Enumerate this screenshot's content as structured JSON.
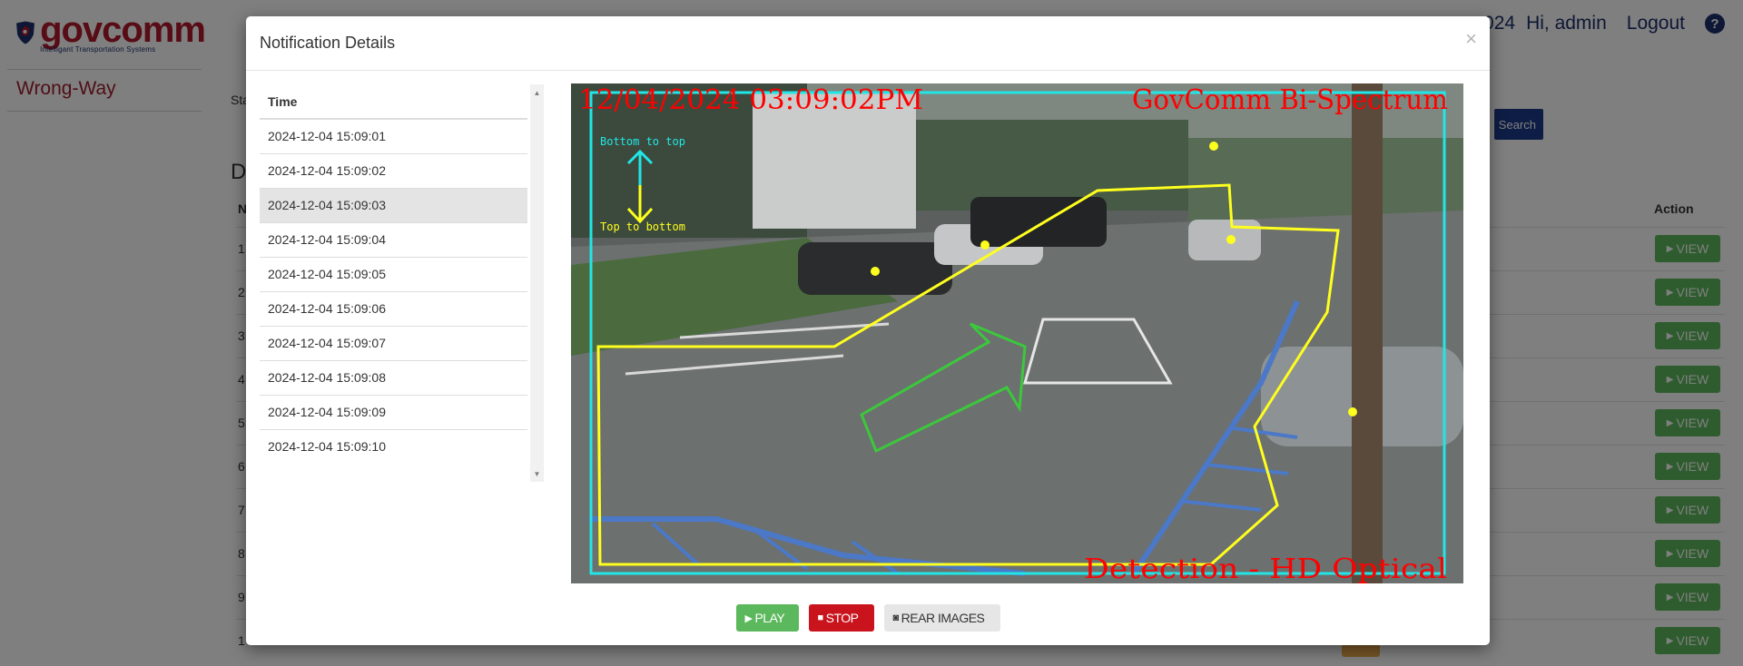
{
  "brand": {
    "name": "govcomm",
    "tagline": "Intelligant Transportation Systems"
  },
  "sidebar": {
    "active_item": "Wrong-Way"
  },
  "header": {
    "date_fragment": "024",
    "greeting": "Hi, admin",
    "logout": "Logout",
    "help": "?"
  },
  "background": {
    "search_button": "Search",
    "action_header": "Action",
    "view_label": "VIEW",
    "fragments": {
      "sta": "Sta",
      "d": "D",
      "n": "N",
      "rows": [
        "1",
        "2",
        "3",
        "4",
        "5",
        "6",
        "7",
        "8",
        "9",
        "1"
      ]
    }
  },
  "modal": {
    "title": "Notification Details",
    "close": "×",
    "table": {
      "header": "Time",
      "rows": [
        "2024-12-04 15:09:01",
        "2024-12-04 15:09:02",
        "2024-12-04 15:09:03",
        "2024-12-04 15:09:04",
        "2024-12-04 15:09:05",
        "2024-12-04 15:09:06",
        "2024-12-04 15:09:07",
        "2024-12-04 15:09:08",
        "2024-12-04 15:09:09",
        "2024-12-04 15:09:10"
      ],
      "selected_index": 2
    },
    "camera": {
      "timestamp": "12/04/2024 03:09:02PM",
      "camera_name": "GovComm Bi-Spectrum",
      "detection_label": "Detection - HD Optical",
      "direction_up": "Bottom to top",
      "direction_down": "Top to bottom"
    },
    "buttons": {
      "play": "PLAY",
      "stop": "STOP",
      "rear_images": "REAR IMAGES"
    }
  },
  "colors": {
    "brand_red": "#b0182a",
    "brand_navy": "#1c2f6b",
    "view_green": "#5cb85c",
    "stop_red": "#c9141d",
    "zone_yellow": "#ffff1e",
    "frame_cyan": "#22e6e6"
  },
  "icons": {
    "play": "play-triangle",
    "stop": "stop-square",
    "rear": "camera",
    "logo": "shield-mark",
    "help": "question-circle"
  }
}
